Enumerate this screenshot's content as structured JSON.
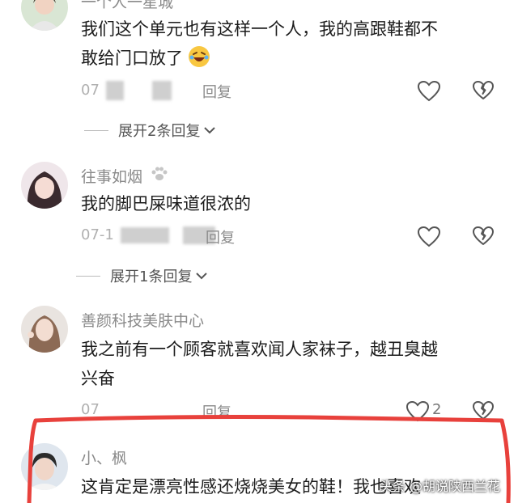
{
  "comments": [
    {
      "username": "一个人一星城",
      "text_line1": "我们这个单元也有这样一个人，我的高跟鞋都不",
      "text_line2": "敢给门口放了",
      "date_prefix": "07",
      "reply": "回复",
      "expand": "展开2条回复"
    },
    {
      "username": "往事如烟",
      "text_line1": "我的脚巴屎味道很浓的",
      "date_prefix": "07-1",
      "reply": "回复",
      "expand": "展开1条回复"
    },
    {
      "username": "善颜科技美肤中心",
      "text_line1": "我之前有一个顾客就喜欢闻人家袜子，越丑臭越",
      "text_line2": "兴奋",
      "date_prefix": "07",
      "reply": "回复",
      "like_count": "2"
    },
    {
      "username": "小、枫",
      "text_line1": "这肯定是漂亮性感还烧烧美女的鞋！我也喜欢"
    }
  ],
  "watermark": "头条 @胡说陕西兰花",
  "icons": {
    "like": "heart-outline-icon",
    "dislike": "broken-heart-icon",
    "chevron": "chevron-down-icon",
    "paw": "paw-icon",
    "emoji": "laughing-emoji-icon"
  },
  "colors": {
    "username": "#8a8a8a",
    "text": "#1c1c1c",
    "annotation": "#e8413c"
  }
}
